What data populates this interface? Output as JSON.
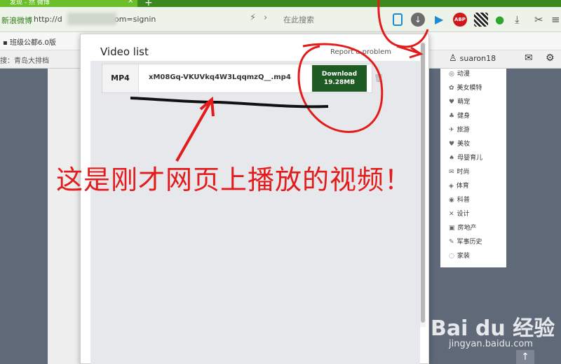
{
  "browser": {
    "tab_title": "发现 - 然 微博",
    "tab_close": "×",
    "new_tab": "+",
    "site_label": "新浪微博",
    "url": "http://d",
    "url_suffix": "rom=signin",
    "search_placeholder": "在此搜索",
    "bookmark": "班级公都6.0版",
    "abp_label": "ABP"
  },
  "page": {
    "search_label": "搜：青岛大排档",
    "username": "suaron18",
    "right_menu": [
      {
        "icon": "◎",
        "label": "动漫"
      },
      {
        "icon": "✿",
        "label": "美女模特"
      },
      {
        "icon": "♥",
        "label": "萌宠"
      },
      {
        "icon": "♣",
        "label": "健身"
      },
      {
        "icon": "✈",
        "label": "旅游"
      },
      {
        "icon": "♥",
        "label": "美妆"
      },
      {
        "icon": "♠",
        "label": "母婴育儿"
      },
      {
        "icon": "✉",
        "label": "时尚"
      },
      {
        "icon": "◈",
        "label": "体育"
      },
      {
        "icon": "◉",
        "label": "科普"
      },
      {
        "icon": "✕",
        "label": "设计"
      },
      {
        "icon": "▣",
        "label": "房地产"
      },
      {
        "icon": "✎",
        "label": "军事历史"
      },
      {
        "icon": "◌",
        "label": "家装"
      }
    ]
  },
  "popup": {
    "title": "Video list",
    "report": "Report a problem",
    "row": {
      "format": "MP4",
      "filename": "xM08Gq-VKUVkq4W3LqqmzQ__.mp4",
      "download_label": "Download",
      "download_size": "19.28MB"
    }
  },
  "annotation": {
    "text": "这是刚才网页上播放的视频！",
    "color": "#e41b1b"
  },
  "watermark": {
    "logo": "Bai du 经验",
    "sub": "jingyan.baidu.com"
  }
}
